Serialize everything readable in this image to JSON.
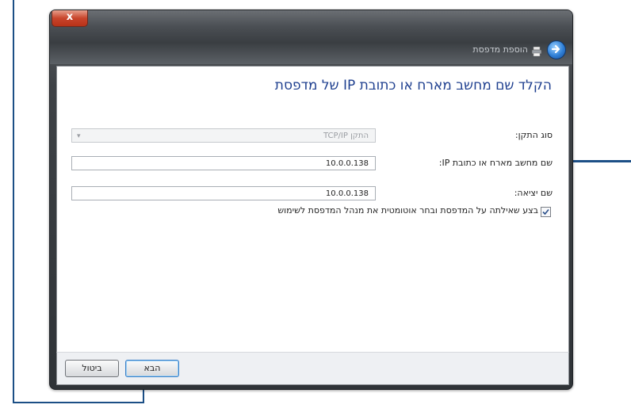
{
  "window": {
    "title": "הוספת מדפסת",
    "close_label": "x"
  },
  "content": {
    "heading": "הקלד שם מחשב מארח או כתובת IP של מדפסת",
    "device_type": {
      "label": "סוג התקן:",
      "value": "התקן TCP/IP"
    },
    "hostname": {
      "label": "שם מחשב מארח או כתובת IP:",
      "value": "10.0.0.138"
    },
    "port_name": {
      "label": "שם יציאה:",
      "value": "10.0.0.138"
    },
    "query_printer": {
      "label": "בצע שאילתה על המדפסת ובחר אוטומטית את מנהל המדפסת לשימוש",
      "checked": true
    }
  },
  "footer": {
    "next_label": "הבא",
    "cancel_label": "ביטול"
  },
  "colors": {
    "annotation": "#1c4f86",
    "heading": "#1e3f8f"
  }
}
